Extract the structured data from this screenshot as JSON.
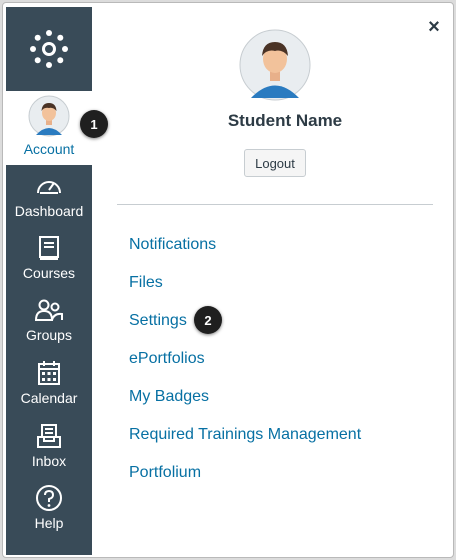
{
  "close": {
    "symbol": "×"
  },
  "profile": {
    "name": "Student Name",
    "logout_label": "Logout"
  },
  "sidebar": {
    "account_label": "Account",
    "items": [
      {
        "label": "Dashboard",
        "icon": "dashboard-icon"
      },
      {
        "label": "Courses",
        "icon": "courses-icon"
      },
      {
        "label": "Groups",
        "icon": "groups-icon"
      },
      {
        "label": "Calendar",
        "icon": "calendar-icon"
      },
      {
        "label": "Inbox",
        "icon": "inbox-icon"
      },
      {
        "label": "Help",
        "icon": "help-icon"
      }
    ]
  },
  "menu": {
    "links": [
      "Notifications",
      "Files",
      "Settings",
      "ePortfolios",
      "My Badges",
      "Required Trainings Management",
      "Portfolium"
    ]
  },
  "callouts": [
    "1",
    "2"
  ],
  "colors": {
    "nav_bg": "#394b58",
    "link": "#0770a3",
    "text": "#2d3b45"
  }
}
